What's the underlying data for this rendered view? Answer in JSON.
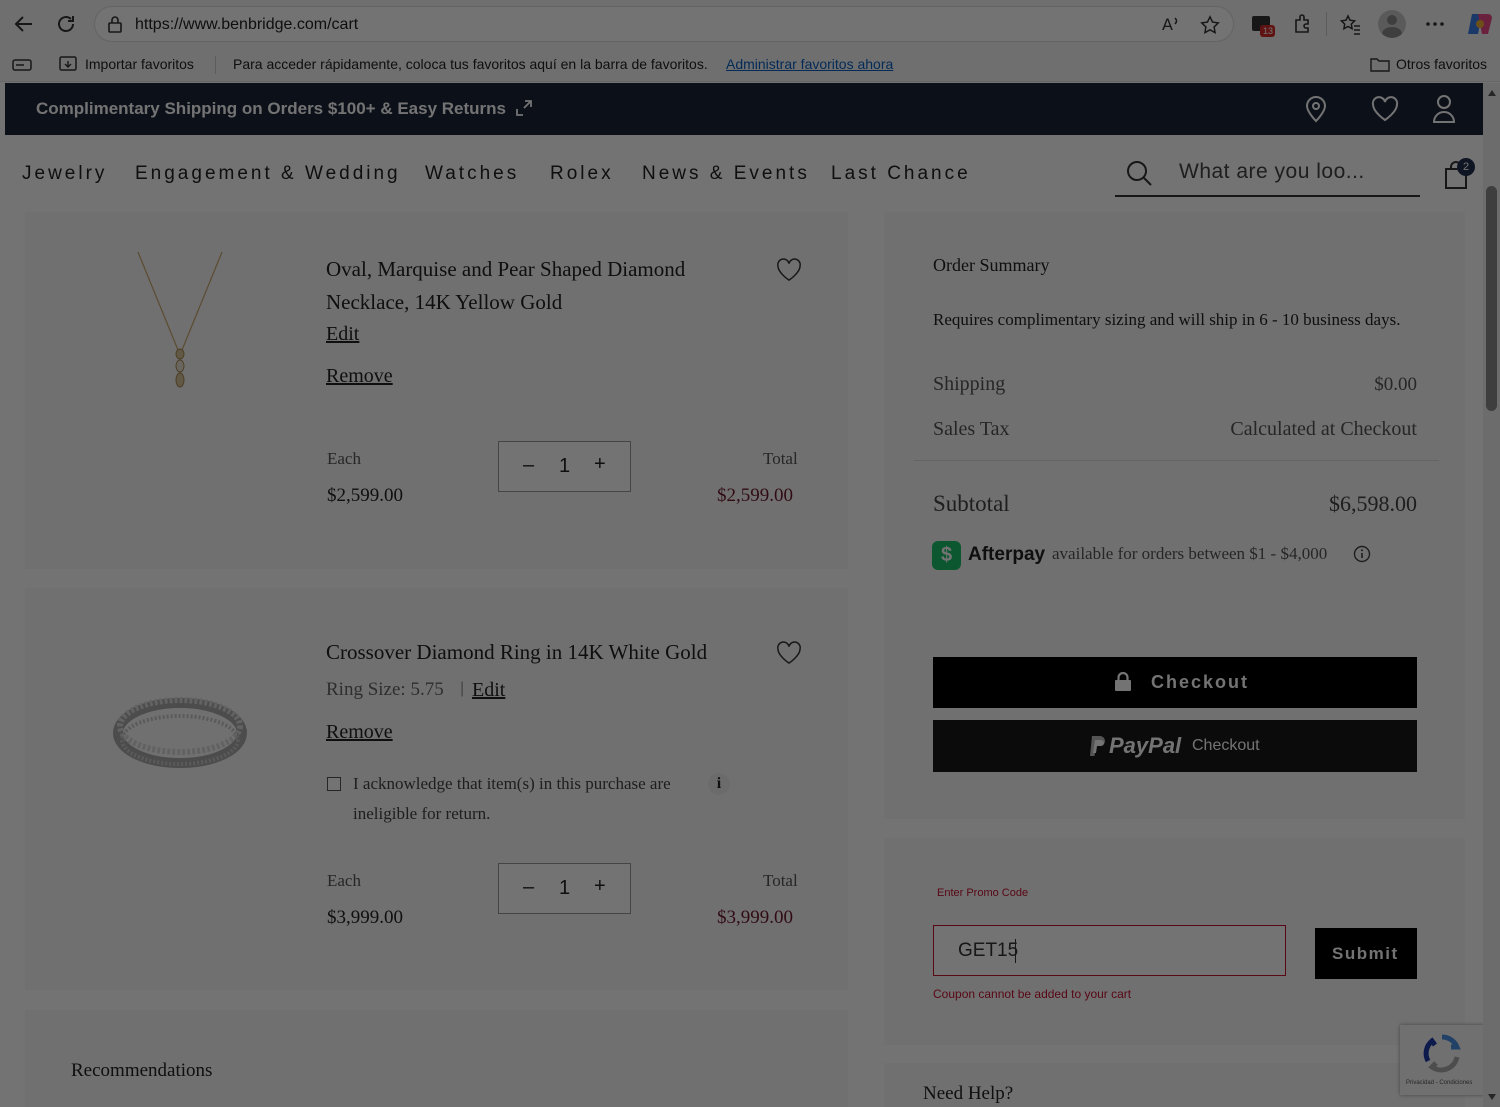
{
  "browser": {
    "url": "https://www.benbridge.com/cart",
    "notification_count": "13",
    "bookmarks": {
      "import_label": "Importar favoritos",
      "hint_text": "Para acceder rápidamente, coloca tus favoritos aquí en la barra de favoritos.",
      "manage_link": "Administrar favoritos ahora",
      "other_label": "Otros favoritos"
    }
  },
  "promo": {
    "text": "Complimentary Shipping on Orders $100+ & Easy Returns"
  },
  "nav": {
    "items": [
      "Jewelry",
      "Engagement & Wedding",
      "Watches",
      "Rolex",
      "News & Events",
      "Last Chance"
    ],
    "search_placeholder": "What are you loo...",
    "cart_count": "2"
  },
  "cart": {
    "items": [
      {
        "title_line1": "Oval, Marquise and Pear Shaped Diamond",
        "title_line2": "Necklace, 14K Yellow Gold",
        "edit": "Edit",
        "remove": "Remove",
        "each_label": "Each",
        "each_price": "$2,599.00",
        "qty": "1",
        "total_label": "Total",
        "total_price": "$2,599.00"
      },
      {
        "title_line1": "Crossover Diamond Ring in 14K White Gold",
        "size_label": "Ring Size: 5.75",
        "edit": "Edit",
        "remove": "Remove",
        "ack_line1": "I acknowledge that item(s) in this purchase are",
        "ack_line2": "ineligible for return.",
        "info_glyph": "i",
        "each_label": "Each",
        "each_price": "$3,999.00",
        "qty": "1",
        "total_label": "Total",
        "total_price": "$3,999.00"
      }
    ],
    "recommendations_label": "Recommendations"
  },
  "summary": {
    "title": "Order Summary",
    "sizing_note": "Requires complimentary sizing and will ship in 6 - 10 business days.",
    "shipping_label": "Shipping",
    "shipping_value": "$0.00",
    "tax_label": "Sales Tax",
    "tax_value": "Calculated at Checkout",
    "subtotal_label": "Subtotal",
    "subtotal_value": "$6,598.00",
    "afterpay_brand": "Afterpay",
    "afterpay_text": "available for orders between $1 - $4,000",
    "checkout_label": "Checkout",
    "paypal_brand": "PayPal",
    "paypal_checkout": "Checkout"
  },
  "promo_code": {
    "label": "Enter Promo Code",
    "value": "GET15",
    "submit_label": "Submit",
    "error": "Coupon cannot be added to your cart"
  },
  "help": {
    "title": "Need Help?"
  },
  "recaptcha": {
    "caption": "Privacidad - Condiciones"
  },
  "colors": {
    "promo_bar": "#1c2538",
    "price_total": "#6c1a2f",
    "error": "#c41230",
    "afterpay_badge": "#1ec26b"
  }
}
